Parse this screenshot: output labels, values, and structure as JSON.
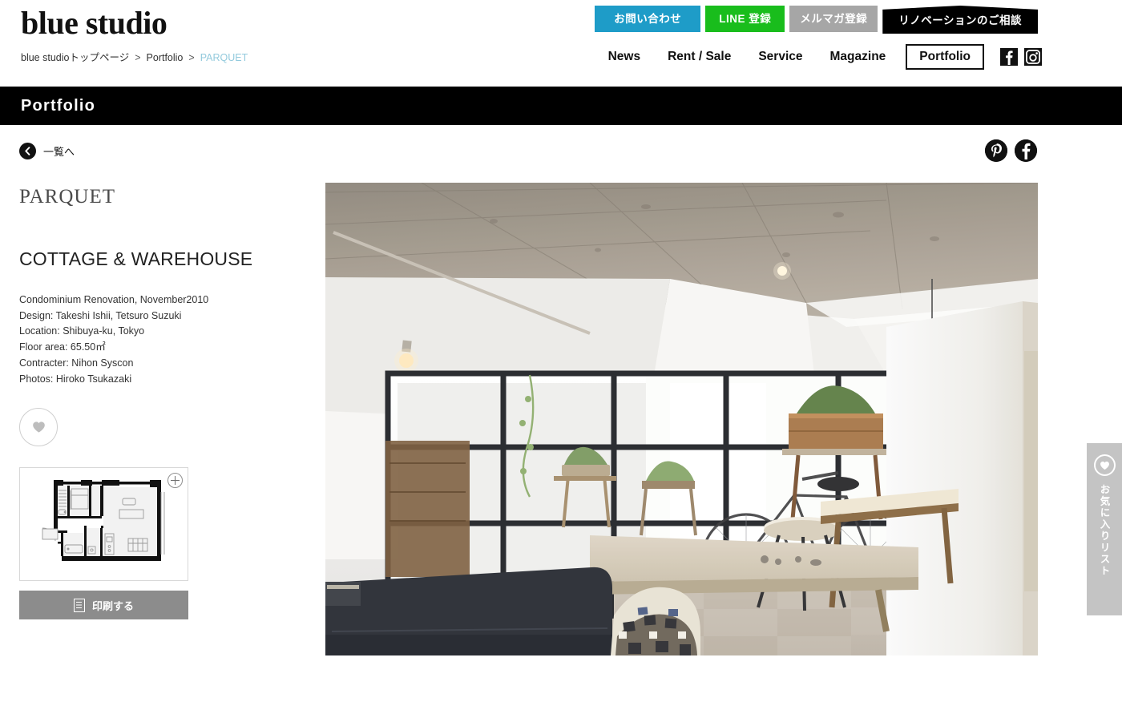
{
  "site": {
    "logo": "blue studio"
  },
  "breadcrumb": {
    "home": "blue studioトップページ",
    "sep1": ">",
    "section": "Portfolio",
    "sep2": ">",
    "current": "PARQUET"
  },
  "top_actions": {
    "contact": "お問い合わせ",
    "line": "LINE 登録",
    "mailmag": "メルマガ登録",
    "renovation": "リノベーションのご相談"
  },
  "nav": {
    "items": [
      {
        "label": "News",
        "active": false
      },
      {
        "label": "Rent / Sale",
        "active": false
      },
      {
        "label": "Service",
        "active": false
      },
      {
        "label": "Magazine",
        "active": false
      },
      {
        "label": "Portfolio",
        "active": true
      }
    ],
    "social": [
      {
        "name": "facebook-icon",
        "glyph": "f"
      },
      {
        "name": "instagram-icon",
        "glyph": "◙"
      }
    ]
  },
  "page_bar": {
    "title": "Portfolio"
  },
  "sub_bar": {
    "back_label": "一覧へ",
    "share": [
      {
        "name": "pinterest-share-icon",
        "glyph": "P"
      },
      {
        "name": "facebook-share-icon",
        "glyph": "f"
      }
    ]
  },
  "project": {
    "brandmark": "PARQUET",
    "title": "COTTAGE & WAREHOUSE",
    "specs": [
      "Condominium Renovation, November2010",
      "Design: Takeshi Ishii, Tetsuro Suzuki",
      "Location: Shibuya-ku, Tokyo",
      "Floor area: 65.50㎡",
      "Contracter: Nihon Syscon",
      "Photos: Hiroko Tsukazaki"
    ],
    "favorite_icon": "heart-icon",
    "floorplan_zoom": "+",
    "print_label": "印刷する",
    "photo_alt": "Renovated condominium interior with exposed concrete ceiling, black-framed glass partition, wooden table, dark sofa, bicycle and plants"
  },
  "favorites_tab": {
    "label": "お気に入りリスト",
    "icon": "heart-icon"
  },
  "colors": {
    "contact_blue": "#1e9cc8",
    "line_green": "#19bd1c",
    "mailmag_gray": "#a6a6a6",
    "reno_black": "#000000",
    "breadcrumb_current": "#93cadd",
    "print_gray": "#8c8c8c",
    "fav_tab_gray": "#c4c4c4"
  }
}
